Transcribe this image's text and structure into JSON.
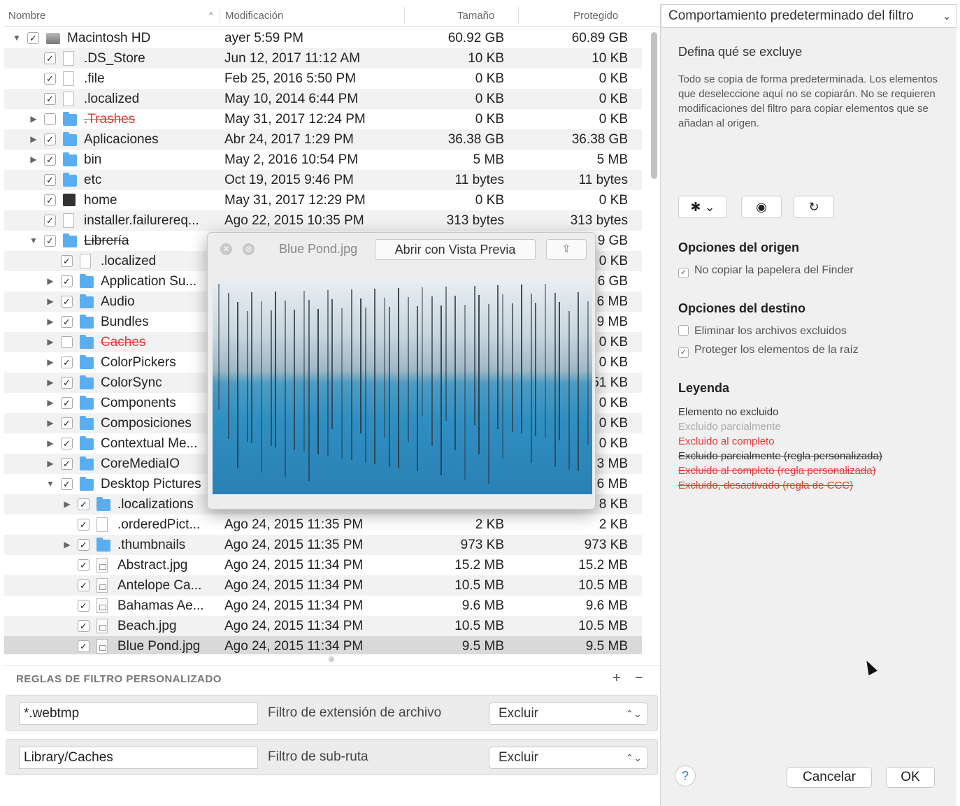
{
  "columns": {
    "name": "Nombre",
    "modified": "Modificación",
    "size": "Tamaño",
    "protected": "Protegido"
  },
  "rows": [
    {
      "depth": 0,
      "tri": "▼",
      "checked": true,
      "icon": "disk",
      "name": "Macintosh HD",
      "modified": "ayer 5:59 PM",
      "size": "60.92 GB",
      "protected": "60.89 GB",
      "style": "normal"
    },
    {
      "depth": 1,
      "tri": "",
      "checked": true,
      "icon": "file",
      "name": ".DS_Store",
      "modified": "Jun 12, 2017 11:12 AM",
      "size": "10 KB",
      "protected": "10 KB",
      "style": "normal"
    },
    {
      "depth": 1,
      "tri": "",
      "checked": true,
      "icon": "file",
      "name": ".file",
      "modified": "Feb 25, 2016 5:50 PM",
      "size": "0 KB",
      "protected": "0 KB",
      "style": "normal"
    },
    {
      "depth": 1,
      "tri": "",
      "checked": true,
      "icon": "file",
      "name": ".localized",
      "modified": "May 10, 2014 6:44 PM",
      "size": "0 KB",
      "protected": "0 KB",
      "style": "normal"
    },
    {
      "depth": 1,
      "tri": "▶",
      "checked": false,
      "icon": "folder",
      "name": ".Trashes",
      "modified": "May 31, 2017 12:24 PM",
      "size": "0 KB",
      "protected": "0 KB",
      "style": "strike-red"
    },
    {
      "depth": 1,
      "tri": "▶",
      "checked": true,
      "icon": "folder",
      "name": "Aplicaciones",
      "modified": "Abr 24, 2017 1:29 PM",
      "size": "36.38 GB",
      "protected": "36.38 GB",
      "style": "normal"
    },
    {
      "depth": 1,
      "tri": "▶",
      "checked": true,
      "icon": "folder",
      "name": "bin",
      "modified": "May 2, 2016 10:54 PM",
      "size": "5 MB",
      "protected": "5 MB",
      "style": "normal"
    },
    {
      "depth": 1,
      "tri": "",
      "checked": true,
      "icon": "folder",
      "name": "etc",
      "modified": "Oct 19, 2015 9:46 PM",
      "size": "11 bytes",
      "protected": "11 bytes",
      "style": "normal"
    },
    {
      "depth": 1,
      "tri": "",
      "checked": true,
      "icon": "home",
      "name": "home",
      "modified": "May 31, 2017 12:29 PM",
      "size": "0 KB",
      "protected": "0 KB",
      "style": "normal"
    },
    {
      "depth": 1,
      "tri": "",
      "checked": true,
      "icon": "file",
      "name": "installer.failurereq...",
      "modified": "Ago 22, 2015 10:35 PM",
      "size": "313 bytes",
      "protected": "313 bytes",
      "style": "normal"
    },
    {
      "depth": 1,
      "tri": "▼",
      "checked": true,
      "icon": "folder",
      "name": "Librería",
      "modified": "",
      "size": "",
      "protected": "9 GB",
      "style": "strike"
    },
    {
      "depth": 2,
      "tri": "",
      "checked": true,
      "icon": "file",
      "name": ".localized",
      "modified": "",
      "size": "",
      "protected": "0 KB",
      "style": "normal"
    },
    {
      "depth": 2,
      "tri": "▶",
      "checked": true,
      "icon": "folder",
      "name": "Application Su...",
      "modified": "",
      "size": "",
      "protected": "6 GB",
      "style": "normal"
    },
    {
      "depth": 2,
      "tri": "▶",
      "checked": true,
      "icon": "folder",
      "name": "Audio",
      "modified": "",
      "size": "",
      "protected": "6 MB",
      "style": "normal"
    },
    {
      "depth": 2,
      "tri": "▶",
      "checked": true,
      "icon": "folder",
      "name": "Bundles",
      "modified": "",
      "size": "",
      "protected": "9 MB",
      "style": "normal"
    },
    {
      "depth": 2,
      "tri": "▶",
      "checked": false,
      "icon": "folder",
      "name": "Caches",
      "modified": "",
      "size": "",
      "protected": "0 KB",
      "style": "strike-red"
    },
    {
      "depth": 2,
      "tri": "▶",
      "checked": true,
      "icon": "folder",
      "name": "ColorPickers",
      "modified": "",
      "size": "",
      "protected": "0 KB",
      "style": "normal"
    },
    {
      "depth": 2,
      "tri": "▶",
      "checked": true,
      "icon": "folder",
      "name": "ColorSync",
      "modified": "",
      "size": "",
      "protected": "51 KB",
      "style": "normal"
    },
    {
      "depth": 2,
      "tri": "▶",
      "checked": true,
      "icon": "folder",
      "name": "Components",
      "modified": "",
      "size": "",
      "protected": "0 KB",
      "style": "normal"
    },
    {
      "depth": 2,
      "tri": "▶",
      "checked": true,
      "icon": "folder",
      "name": "Composiciones",
      "modified": "",
      "size": "",
      "protected": "0 KB",
      "style": "normal"
    },
    {
      "depth": 2,
      "tri": "▶",
      "checked": true,
      "icon": "folder",
      "name": "Contextual Me...",
      "modified": "",
      "size": "",
      "protected": "0 KB",
      "style": "normal"
    },
    {
      "depth": 2,
      "tri": "▶",
      "checked": true,
      "icon": "folder",
      "name": "CoreMediaIO",
      "modified": "",
      "size": "",
      "protected": "3 MB",
      "style": "normal"
    },
    {
      "depth": 2,
      "tri": "▼",
      "checked": true,
      "icon": "folder",
      "name": "Desktop Pictures",
      "modified": "",
      "size": "",
      "protected": "6 MB",
      "style": "normal"
    },
    {
      "depth": 3,
      "tri": "▶",
      "checked": true,
      "icon": "folder",
      "name": ".localizations",
      "modified": "",
      "size": "",
      "protected": "8 KB",
      "style": "normal"
    },
    {
      "depth": 3,
      "tri": "",
      "checked": true,
      "icon": "file",
      "name": ".orderedPict...",
      "modified": "Ago 24, 2015 11:35 PM",
      "size": "2 KB",
      "protected": "2 KB",
      "style": "normal"
    },
    {
      "depth": 3,
      "tri": "▶",
      "checked": true,
      "icon": "folder",
      "name": ".thumbnails",
      "modified": "Ago 24, 2015 11:35 PM",
      "size": "973 KB",
      "protected": "973 KB",
      "style": "normal"
    },
    {
      "depth": 3,
      "tri": "",
      "checked": true,
      "icon": "img",
      "name": "Abstract.jpg",
      "modified": "Ago 24, 2015 11:34 PM",
      "size": "15.2 MB",
      "protected": "15.2 MB",
      "style": "normal"
    },
    {
      "depth": 3,
      "tri": "",
      "checked": true,
      "icon": "img",
      "name": "Antelope Ca...",
      "modified": "Ago 24, 2015 11:34 PM",
      "size": "10.5 MB",
      "protected": "10.5 MB",
      "style": "normal"
    },
    {
      "depth": 3,
      "tri": "",
      "checked": true,
      "icon": "img",
      "name": "Bahamas Ae...",
      "modified": "Ago 24, 2015 11:34 PM",
      "size": "9.6 MB",
      "protected": "9.6 MB",
      "style": "normal"
    },
    {
      "depth": 3,
      "tri": "",
      "checked": true,
      "icon": "img",
      "name": "Beach.jpg",
      "modified": "Ago 24, 2015 11:34 PM",
      "size": "10.5 MB",
      "protected": "10.5 MB",
      "style": "normal"
    },
    {
      "depth": 3,
      "tri": "",
      "checked": true,
      "icon": "img",
      "name": "Blue Pond.jpg",
      "modified": "Ago 24, 2015 11:34 PM",
      "size": "9.5 MB",
      "protected": "9.5 MB",
      "style": "selected"
    }
  ],
  "quicklook": {
    "title": "Blue Pond.jpg",
    "open_label": "Abrir con Vista Previa",
    "close_icon": "close-icon",
    "fullscreen_icon": "fullscreen-icon",
    "share_icon": "share-icon"
  },
  "filters": {
    "header": "REGLAS DE FILTRO PERSONALIZADO",
    "add": "+",
    "remove": "−",
    "rules": [
      {
        "value": "*.webtmp",
        "type": "Filtro de extensión de archivo",
        "action": "Excluir"
      },
      {
        "value": "Library/Caches",
        "type": "Filtro de sub-ruta",
        "action": "Excluir"
      }
    ]
  },
  "side": {
    "popup": "Comportamiento predeterminado del filtro",
    "title": "Defina qué se excluye",
    "description": "Todo se copia de forma predeterminada. Los elementos que deseleccione aquí no se copiarán. No se requieren modificaciones del filtro para copiar elementos que se añadan al origen.",
    "source_heading": "Opciones del origen",
    "source_opt": "No copiar la papelera del Finder",
    "dest_heading": "Opciones del destino",
    "dest_opt1": "Eliminar los archivos excluidos",
    "dest_opt2": "Proteger los elementos de la raíz",
    "legend_heading": "Leyenda",
    "legend": [
      {
        "text": "Elemento no excluido",
        "color": "#333333",
        "strike": false
      },
      {
        "text": "Excluido parcialmente",
        "color": "#aaaaaa",
        "strike": false
      },
      {
        "text": "Excluido al completo",
        "color": "#e53935",
        "strike": false
      },
      {
        "text": "Excluido parcialmente (regla personalizada)",
        "color": "#333333",
        "strike": true
      },
      {
        "text": "Excluido al completo (regla personalizada)",
        "color": "#e53935",
        "strike": true
      },
      {
        "text": "Excluido, desactivado (regla de CCC)",
        "color": "#e53935",
        "strike": true
      }
    ],
    "help": "?",
    "cancel": "Cancelar",
    "ok": "OK"
  }
}
